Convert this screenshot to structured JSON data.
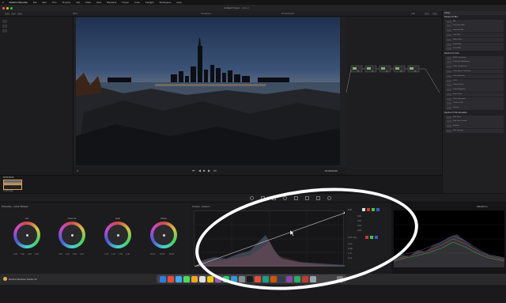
{
  "menubar": {
    "apple": "",
    "items": [
      "DaVinci Resolve",
      "File",
      "Edit",
      "Trim",
      "Timeline",
      "Clip",
      "Mark",
      "View",
      "Playback",
      "Fusion",
      "Color",
      "Fairlight",
      "Workspace",
      "Help"
    ]
  },
  "titlebar": {
    "project_title": "Untitled Project",
    "project_status": "Edited",
    "timeline_name": "Timeline 1",
    "zoom": "35%",
    "clip_label": "Clip"
  },
  "viewer": {
    "timecode_left": "00:00:00:00",
    "timecode_right": "01:00:03:20",
    "watermark": "NO SIGNAL"
  },
  "nodes": {
    "labels": [
      "01",
      "02",
      "03",
      "04",
      "05"
    ]
  },
  "library": {
    "title": "Library",
    "sections": [
      {
        "title": "Resolve FX Blur",
        "items": [
          "Blur",
          "Directional Blur",
          "Gaussian Blur",
          "Lens Blur",
          "Mosaic Blur",
          "Radial Blur",
          "Zoom Blur"
        ]
      },
      {
        "title": "Resolve FX Color",
        "items": [
          "ACES Transform",
          "Chromatic Adaptation",
          "Color Compressor",
          "Color Space Transform",
          "Color Stabilizer",
          "DCTL",
          "Gamut Limiter",
          "Gamut Mapping",
          "Invert Color",
          "Color Generator",
          "Contrast Pop",
          "Dehaze"
        ]
      },
      {
        "title": "Resolve FX Film Emulation",
        "items": [
          "Film Grain",
          "Film Look Creator",
          "Halation",
          "Film Damage"
        ]
      }
    ]
  },
  "clipstrip": {
    "clip_number": "01",
    "clip_timecode": "00:00:00:00",
    "clip_codec": "H.265 Main"
  },
  "primaries": {
    "title": "Primaries - Color Wheels",
    "wheels": [
      {
        "name": "Lift",
        "values": [
          "0.00",
          "0.00",
          "0.00",
          "0.00"
        ]
      },
      {
        "name": "Gamma",
        "values": [
          "0.00",
          "0.00",
          "0.00",
          "0.00"
        ]
      },
      {
        "name": "Gain",
        "values": [
          "1.00",
          "1.00",
          "1.00",
          "1.00"
        ]
      },
      {
        "name": "Offset",
        "values": [
          "25.00",
          "25.00",
          "25.00"
        ]
      }
    ]
  },
  "curves": {
    "title": "Curves - Custom",
    "edit_label": "Edit",
    "soft_clip_label": "Soft Clip",
    "channel_values": [
      "100",
      "100",
      "100",
      "100"
    ],
    "side_labels": [
      "Low",
      "High",
      "L.S.",
      "H.S."
    ]
  },
  "scopes": {
    "title": "Waveform"
  },
  "statusbar": {
    "app_name": "DaVinci Resolve Studio 19"
  },
  "colors": {
    "accent": "#e8a650",
    "menubar": "#151515",
    "panel": "#1d1d1f",
    "highlight": "#ffffff"
  }
}
